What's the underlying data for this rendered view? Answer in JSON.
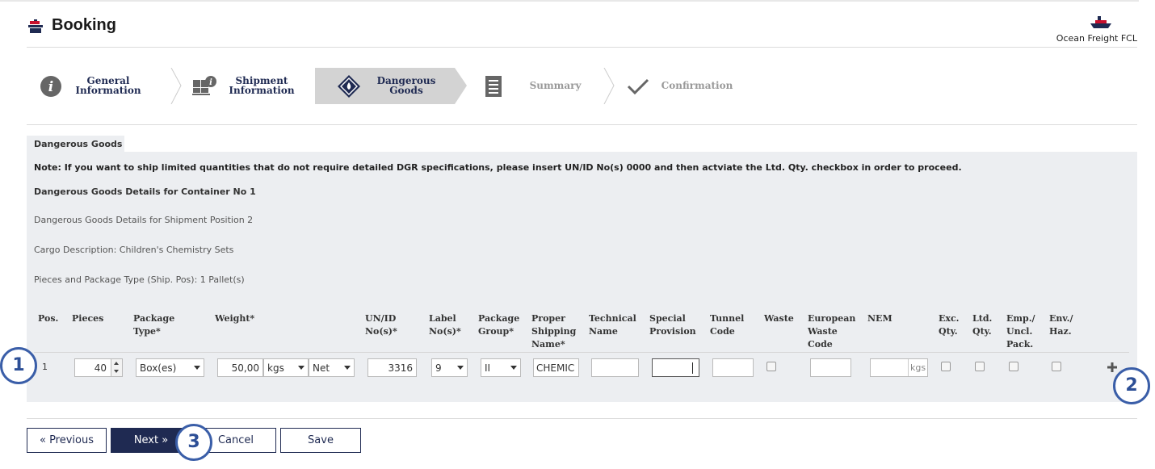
{
  "header": {
    "title": "Booking",
    "mode_label": "Ocean Freight FCL"
  },
  "stepper": [
    {
      "line1": "General",
      "line2": "Information",
      "state": "done"
    },
    {
      "line1": "Shipment",
      "line2": "Information",
      "state": "done"
    },
    {
      "line1": "Dangerous",
      "line2": "Goods",
      "state": "active"
    },
    {
      "line1": "Summary",
      "state": "pending"
    },
    {
      "line1": "Confirmation",
      "state": "pending"
    }
  ],
  "panel": {
    "tab_label": "Dangerous Goods",
    "note": "Note: If you want to ship limited quantities that do not require detailed DGR specifications, please insert UN/ID No(s) 0000 and then actviate the Ltd. Qty. checkbox in order to proceed.",
    "container_title": "Dangerous Goods Details for Container No 1",
    "shipment_position": "Dangerous Goods Details for Shipment Position 2",
    "cargo_description": "Cargo Description: Children's Chemistry Sets",
    "pieces_package": "Pieces and Package Type (Ship. Pos): 1 Pallet(s)"
  },
  "table": {
    "headers": {
      "pos": "Pos.",
      "pieces": "Pieces",
      "package_type": [
        "Package",
        "Type*"
      ],
      "weight": "Weight*",
      "un_id": [
        "UN/ID",
        "No(s)*"
      ],
      "label": [
        "Label",
        "No(s)*"
      ],
      "package_group": [
        "Package",
        "Group*"
      ],
      "proper_shipping": [
        "Proper",
        "Shipping",
        "Name*"
      ],
      "technical": [
        "Technical",
        "Name"
      ],
      "special": [
        "Special",
        "Provision"
      ],
      "tunnel": [
        "Tunnel",
        "Code"
      ],
      "waste": "Waste",
      "european_waste": [
        "European",
        "Waste",
        "Code"
      ],
      "nem": "NEM",
      "exc_qty": [
        "Exc.",
        "Qty."
      ],
      "ltd_qty": [
        "Ltd.",
        "Qty."
      ],
      "emp": [
        "Emp./",
        "Uncl.",
        "Pack."
      ],
      "env": [
        "Env./",
        "Haz."
      ]
    },
    "row": {
      "pos": "1",
      "pieces": "40",
      "package_type": "Box(es)",
      "weight": "50,00",
      "weight_unit": "kgs",
      "weight_kind": "Net",
      "un_id": "3316",
      "label": "9",
      "package_group": "II",
      "proper_shipping": "CHEMIC",
      "nem_unit": "kgs"
    }
  },
  "buttons": {
    "previous": "« Previous",
    "next": "Next »",
    "cancel": "Cancel",
    "save": "Save"
  },
  "badges": {
    "one": "1",
    "two": "2",
    "three": "3"
  },
  "colors": {
    "brand_navy": "#1f2a52",
    "badge_blue": "#3a5ea8",
    "panel_bg": "#eceef1",
    "flag_red": "#c8102e"
  }
}
